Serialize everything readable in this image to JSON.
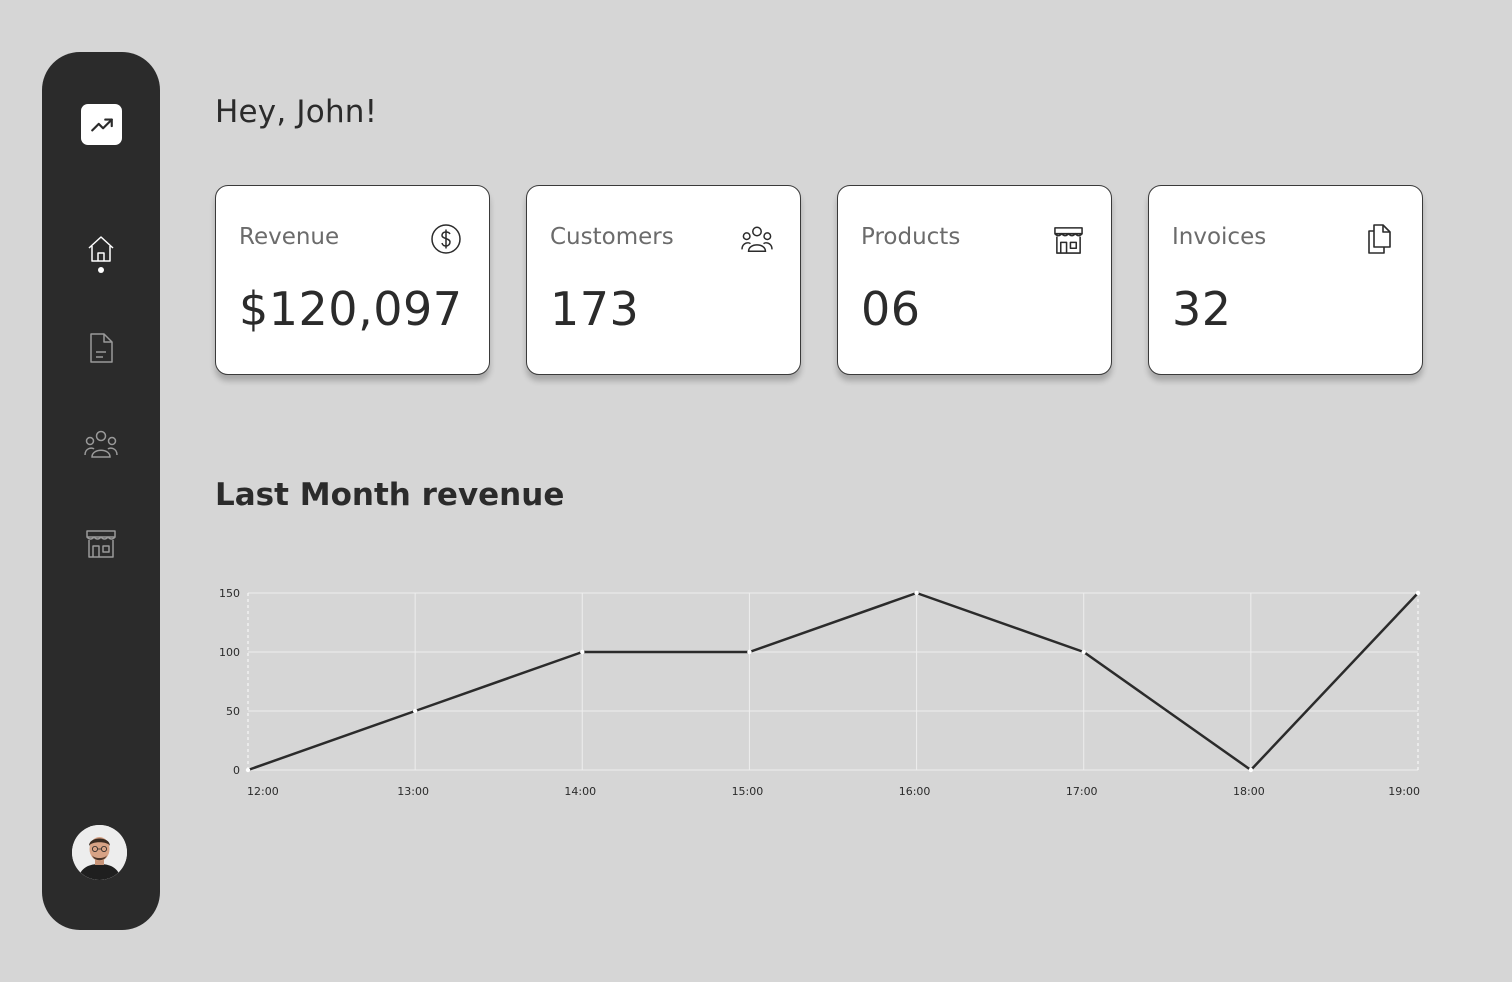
{
  "greeting": "Hey, John!",
  "sidebar": {
    "items": [
      {
        "icon": "home-icon",
        "active": true
      },
      {
        "icon": "document-icon",
        "active": false
      },
      {
        "icon": "users-icon",
        "active": false
      },
      {
        "icon": "store-icon",
        "active": false
      }
    ],
    "logo_icon": "trending-up-icon",
    "avatar": "user-avatar"
  },
  "cards": [
    {
      "label": "Revenue",
      "value": "$120,097",
      "icon": "dollar-icon"
    },
    {
      "label": "Customers",
      "value": "173",
      "icon": "users-icon"
    },
    {
      "label": "Products",
      "value": "06",
      "icon": "store-icon"
    },
    {
      "label": "Invoices",
      "value": "32",
      "icon": "files-icon"
    }
  ],
  "section_title": "Last Month revenue",
  "colors": {
    "background": "#d6d6d6",
    "sidebar": "#2b2b2b",
    "line": "#2b2b2b",
    "grid": "#eeeeee"
  },
  "chart_data": {
    "type": "line",
    "categories": [
      "12:00",
      "13:00",
      "14:00",
      "15:00",
      "16:00",
      "17:00",
      "18:00",
      "19:00"
    ],
    "series": [
      {
        "values": [
          0,
          50,
          100,
          100,
          150,
          100,
          0,
          150
        ]
      }
    ],
    "yticks": [
      "0",
      "50",
      "100",
      "150"
    ],
    "ylim": [
      0,
      150
    ],
    "grid": true
  }
}
